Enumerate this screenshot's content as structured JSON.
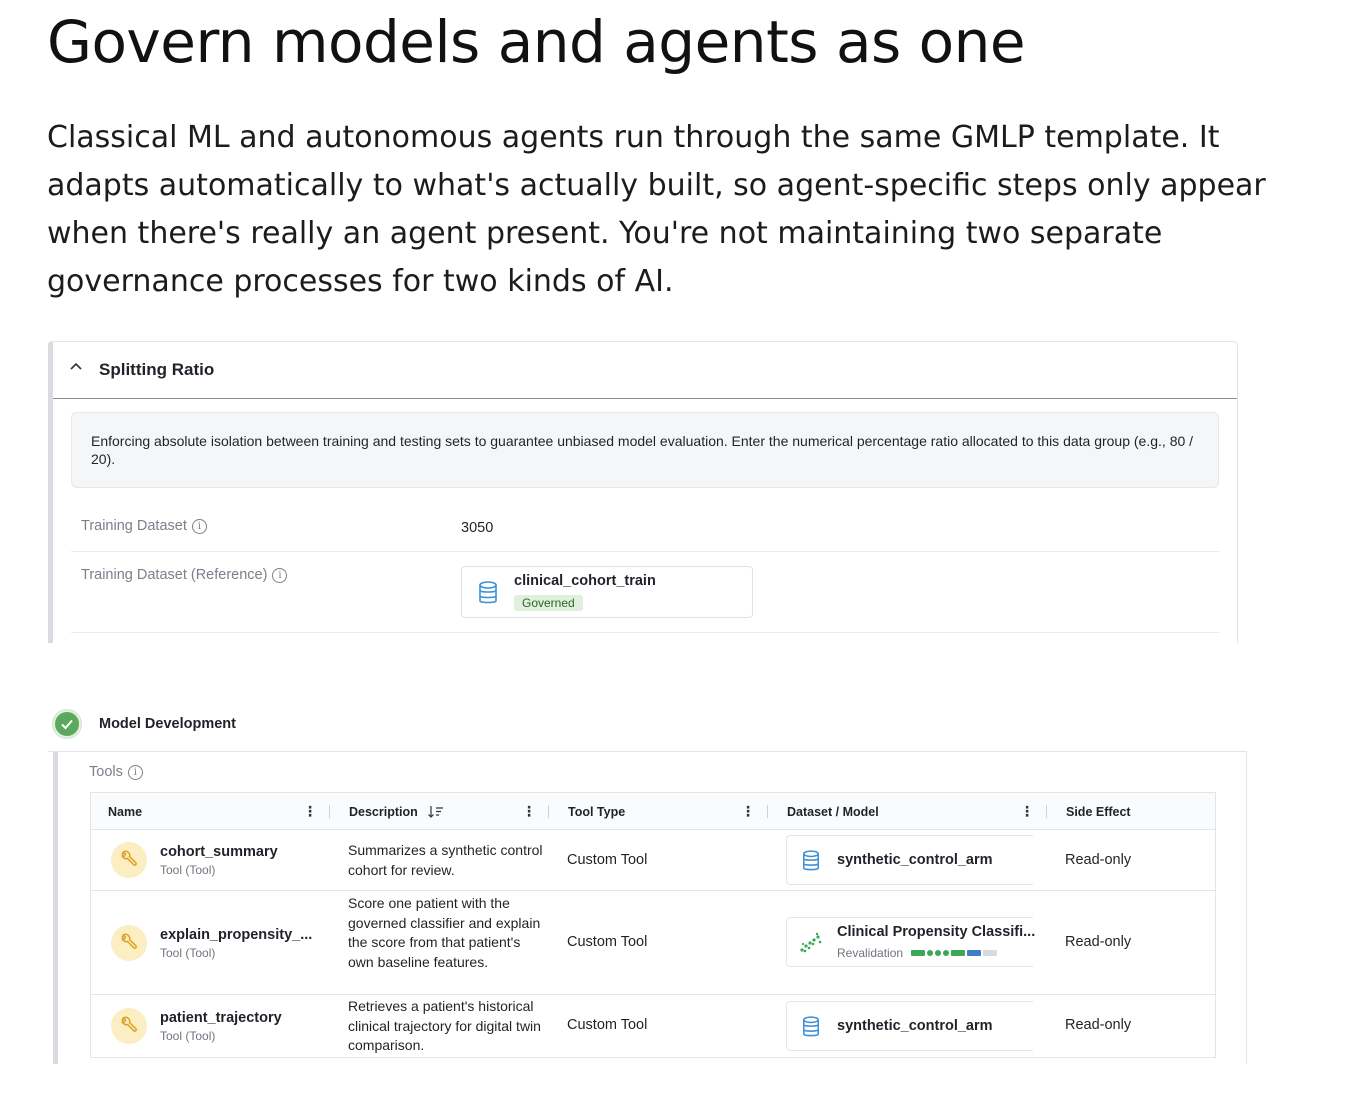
{
  "hero": {
    "title": "Govern models and agents as one",
    "body": "Classical ML and autonomous agents run through the same GMLP template. It adapts automatically to what's actually built, so agent-specific steps only appear when there's really an agent present. You're not maintaining two separate governance processes for two kinds of AI."
  },
  "splitting": {
    "title": "Splitting Ratio",
    "info": "Enforcing absolute isolation between training and testing sets to guarantee unbiased model evaluation. Enter the numerical percentage ratio allocated to this data group (e.g., 80 / 20).",
    "training_label": "Training Dataset",
    "training_value": "3050",
    "reference_label": "Training Dataset (Reference)",
    "reference_name": "clinical_cohort_train",
    "reference_badge": "Governed"
  },
  "model_dev": {
    "title": "Model Development",
    "tools_label": "Tools",
    "columns": {
      "name": "Name",
      "description": "Description",
      "tool_type": "Tool Type",
      "dataset_model": "Dataset / Model",
      "side_effect": "Side Effect"
    },
    "rows": [
      {
        "name": "cohort_summary",
        "sub": "Tool (Tool)",
        "desc": "Summarizes a synthetic control cohort for review.",
        "type": "Custom Tool",
        "dm_name": "synthetic_control_arm",
        "dm_sub": "",
        "dm_icon": "database-icon",
        "side": "Read-only"
      },
      {
        "name": "explain_propensity_...",
        "sub": "Tool (Tool)",
        "desc": "Score one patient with the governed classifier and explain the score from that patient's own baseline features.",
        "type": "Custom Tool",
        "dm_name": "Clinical Propensity Classifi...",
        "dm_sub": "Revalidation",
        "dm_icon": "scatter-model-icon",
        "side": "Read-only"
      },
      {
        "name": "patient_trajectory",
        "sub": "Tool (Tool)",
        "desc": "Retrieves a patient's historical clinical trajectory for digital twin comparison.",
        "type": "Custom Tool",
        "dm_name": "synthetic_control_arm",
        "dm_sub": "",
        "dm_icon": "database-icon",
        "side": "Read-only"
      }
    ]
  },
  "colors": {
    "accent_green": "#5aa95c",
    "badge_green_bg": "#dff0dc",
    "tool_icon_bg": "#fbeec2",
    "db_blue": "#3d8fd6"
  }
}
